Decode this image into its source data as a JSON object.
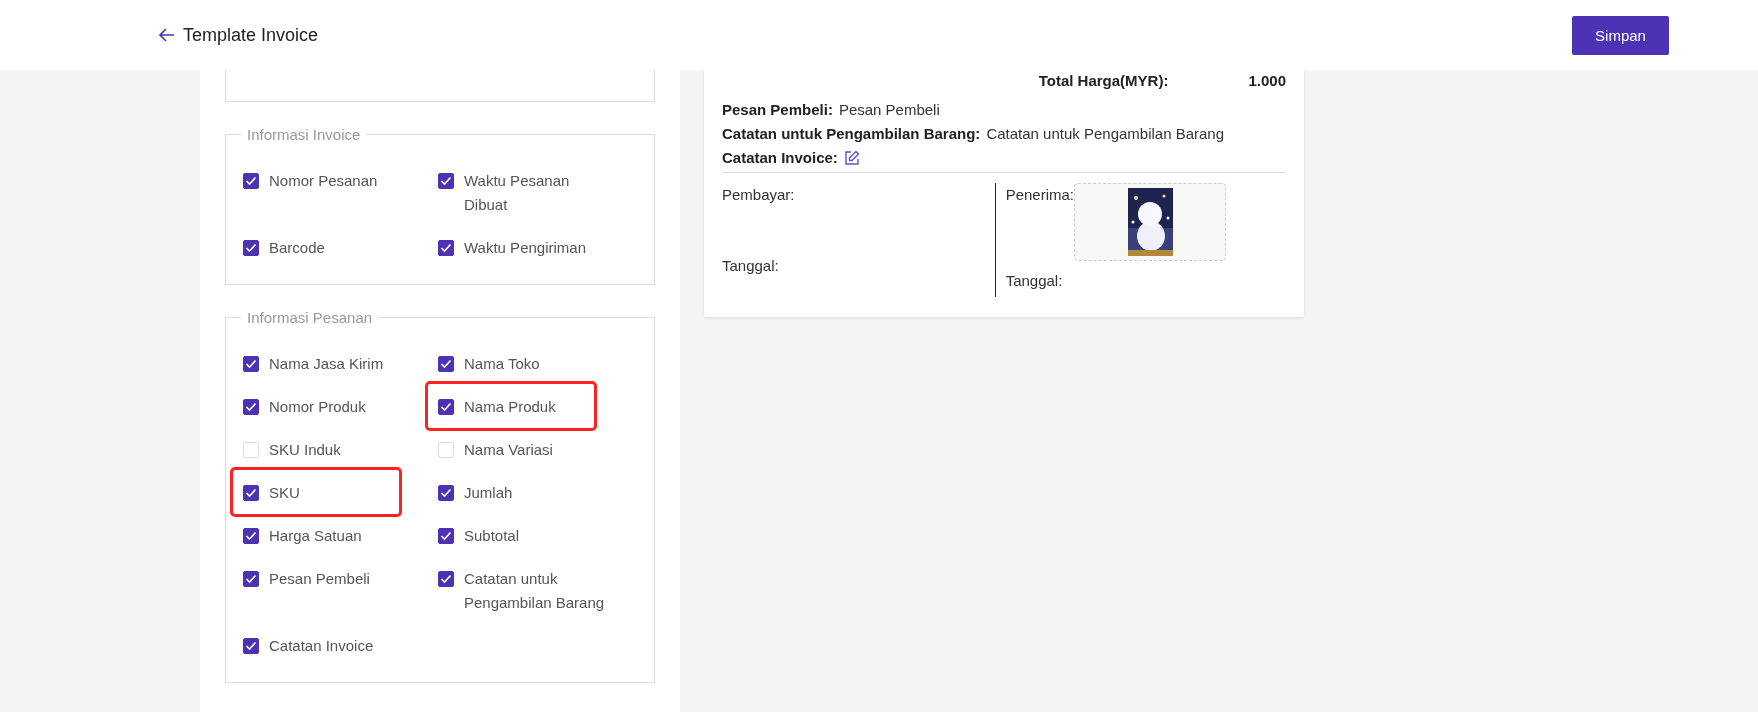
{
  "header": {
    "title": "Template Invoice",
    "save_button": "Simpan"
  },
  "settings": {
    "groups": [
      {
        "legend": "Informasi Invoice",
        "items": [
          {
            "label": "Nomor Pesanan",
            "checked": true,
            "highlighted": false
          },
          {
            "label": "Waktu Pesanan Dibuat",
            "checked": true,
            "highlighted": false
          },
          {
            "label": "Barcode",
            "checked": true,
            "highlighted": false
          },
          {
            "label": "Waktu Pengiriman",
            "checked": true,
            "highlighted": false
          }
        ]
      },
      {
        "legend": "Informasi Pesanan",
        "items": [
          {
            "label": "Nama Jasa Kirim",
            "checked": true,
            "highlighted": false
          },
          {
            "label": "Nama Toko",
            "checked": true,
            "highlighted": false
          },
          {
            "label": "Nomor Produk",
            "checked": true,
            "highlighted": false
          },
          {
            "label": "Nama Produk",
            "checked": true,
            "highlighted": true
          },
          {
            "label": "SKU Induk",
            "checked": false,
            "highlighted": false
          },
          {
            "label": "Nama Variasi",
            "checked": false,
            "highlighted": false
          },
          {
            "label": "SKU",
            "checked": true,
            "highlighted": true
          },
          {
            "label": "Jumlah",
            "checked": true,
            "highlighted": false
          },
          {
            "label": "Harga Satuan",
            "checked": true,
            "highlighted": false
          },
          {
            "label": "Subtotal",
            "checked": true,
            "highlighted": false
          },
          {
            "label": "Pesan Pembeli",
            "checked": true,
            "highlighted": false
          },
          {
            "label": "Catatan untuk Pengambilan Barang",
            "checked": true,
            "highlighted": false
          },
          {
            "label": "Catatan Invoice",
            "checked": true,
            "highlighted": false
          }
        ]
      }
    ]
  },
  "preview": {
    "total": {
      "label": "Total Harga(MYR):",
      "value": "1.000"
    },
    "fields": [
      {
        "kind": "text",
        "label": "Pesan Pembeli:",
        "value": "Pesan Pembeli"
      },
      {
        "kind": "text",
        "label": "Catatan untuk Pengambilan Barang:",
        "value": "Catatan untuk Pengambilan Barang"
      },
      {
        "kind": "edit",
        "label": "Catatan Invoice:"
      }
    ],
    "payer": {
      "label": "Pembayar:",
      "date_label": "Tanggal:"
    },
    "receiver": {
      "label": "Penerima:",
      "date_label": "Tanggal:"
    }
  }
}
